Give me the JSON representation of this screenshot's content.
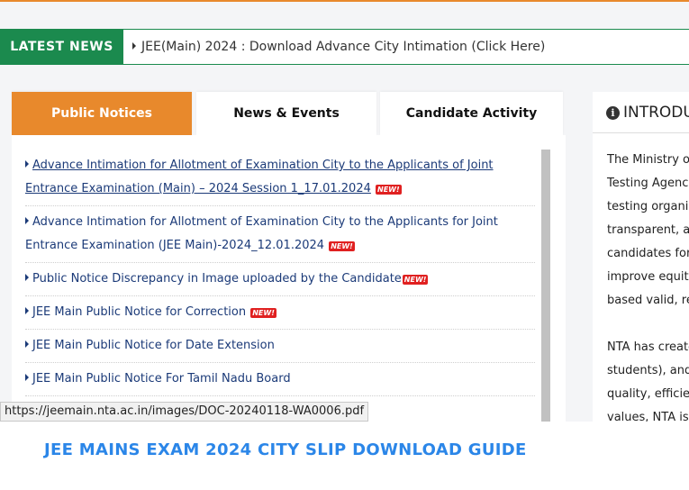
{
  "ticker": {
    "label": "LATEST NEWS",
    "headline": "JEE(Main) 2024 : Download Advance City Intimation (Click Here)"
  },
  "tabs": [
    {
      "label": "Public Notices",
      "active": true
    },
    {
      "label": "News & Events",
      "active": false
    },
    {
      "label": "Candidate Activity",
      "active": false
    }
  ],
  "notices": [
    {
      "line1": "Advance Intimation for Allotment of Examination City to the Applicants of Joint",
      "line2": "Entrance Examination (Main) – 2024 Session 1_17.01.2024",
      "badge": "NEW!"
    },
    {
      "line1": "Advance Intimation for Allotment of Examination City to the Applicants for Joint",
      "line2": "Entrance Examination (JEE Main)-2024_12.01.2024",
      "badge": "NEW!"
    },
    {
      "line1": "Public Notice Discrepancy in Image uploaded by the Candidate",
      "badge": "NEW!"
    },
    {
      "line1": "JEE Main Public Notice for Correction",
      "badge": "NEW!"
    },
    {
      "line1": "JEE Main Public Notice for Date Extension"
    },
    {
      "line1": "JEE Main Public Notice For Tamil Nadu Board"
    }
  ],
  "status_url": "https://jeemain.nta.ac.in/images/DOC-20240118-WA0006.pdf",
  "intro": {
    "heading": "INTRODU",
    "lines": [
      "The Ministry o",
      "Testing Agenc",
      "testing organi",
      "transparent, a",
      "candidates for",
      "improve equit",
      "based valid, re",
      "",
      "NTA has create",
      "students), and",
      "quality, efficie",
      "values, NTA is"
    ]
  },
  "guide_title": "JEE MAINS EXAM 2024 CITY SLIP DOWNLOAD GUIDE",
  "colors": {
    "accent": "#e8892c",
    "news_green": "#1b8a4e",
    "link": "#1b3a78",
    "guide_blue": "#2b86e8"
  }
}
